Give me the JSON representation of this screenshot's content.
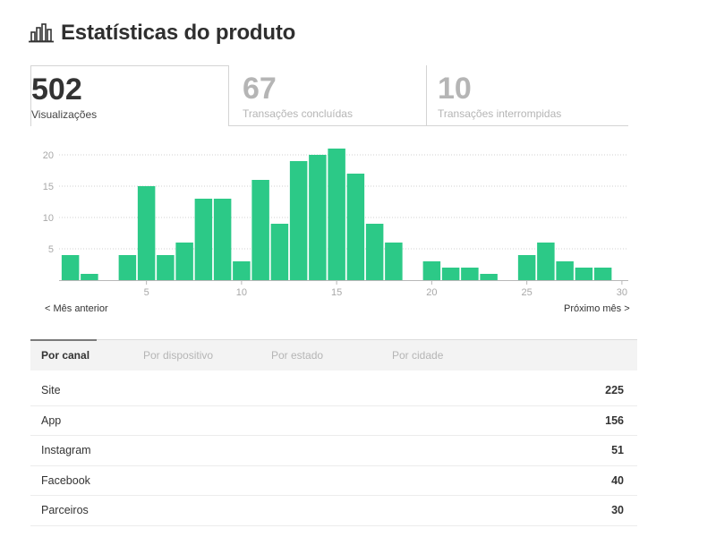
{
  "header": {
    "title": "Estatísticas do produto",
    "icon": "bar-chart-icon"
  },
  "stats": [
    {
      "value": "502",
      "label": "Visualizações",
      "active": true
    },
    {
      "value": "67",
      "label": "Transações concluídas",
      "active": false
    },
    {
      "value": "10",
      "label": "Transações interrompidas",
      "active": false
    }
  ],
  "chart_data": {
    "type": "bar",
    "x": [
      1,
      2,
      3,
      4,
      5,
      6,
      7,
      8,
      9,
      10,
      11,
      12,
      13,
      14,
      15,
      16,
      17,
      18,
      19,
      20,
      21,
      22,
      23,
      24,
      25,
      26,
      27,
      28,
      29,
      30
    ],
    "values": [
      4,
      1,
      0,
      4,
      15,
      4,
      6,
      13,
      13,
      3,
      16,
      9,
      19,
      20,
      21,
      17,
      9,
      6,
      0,
      3,
      2,
      2,
      1,
      0,
      4,
      6,
      3,
      2,
      2,
      0
    ],
    "xticks": [
      5,
      10,
      15,
      20,
      25,
      30
    ],
    "yticks": [
      5,
      10,
      15,
      20
    ],
    "ylim": [
      0,
      22
    ],
    "grid": true,
    "color": "#2cc987"
  },
  "nav": {
    "prev": "< Mês anterior",
    "next": "Próximo mês >"
  },
  "tabs": [
    {
      "label": "Por canal",
      "active": true
    },
    {
      "label": "Por dispositivo",
      "active": false
    },
    {
      "label": "Por estado",
      "active": false
    },
    {
      "label": "Por cidade",
      "active": false
    }
  ],
  "table": [
    {
      "name": "Site",
      "value": "225"
    },
    {
      "name": "App",
      "value": "156"
    },
    {
      "name": "Instagram",
      "value": "51"
    },
    {
      "name": "Facebook",
      "value": "40"
    },
    {
      "name": "Parceiros",
      "value": "30"
    }
  ]
}
